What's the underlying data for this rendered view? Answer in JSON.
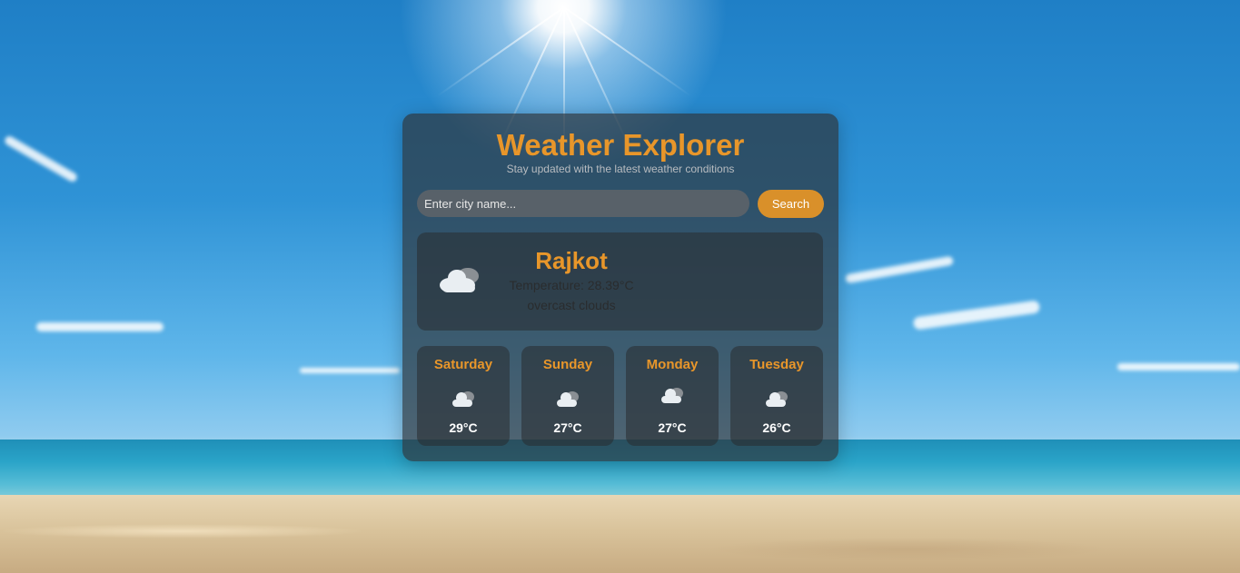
{
  "app": {
    "title": "Weather Explorer",
    "subtitle": "Stay updated with the latest weather conditions"
  },
  "search": {
    "placeholder": "Enter city name...",
    "value": "",
    "button_label": "Search"
  },
  "current": {
    "city": "Rajkot",
    "temperature_text": "Temperature: 28.39°C",
    "description": "overcast clouds",
    "icon": "cloud-icon"
  },
  "forecast": [
    {
      "day": "Saturday",
      "temp": "29°C",
      "icon": "cloud-icon"
    },
    {
      "day": "Sunday",
      "temp": "27°C",
      "icon": "cloud-icon"
    },
    {
      "day": "Monday",
      "temp": "27°C",
      "icon": "cloud-icon"
    },
    {
      "day": "Tuesday",
      "temp": "26°C",
      "icon": "cloud-icon"
    }
  ],
  "colors": {
    "accent": "#e8962a",
    "button": "#d9902a",
    "card_bg": "#2d3237"
  }
}
